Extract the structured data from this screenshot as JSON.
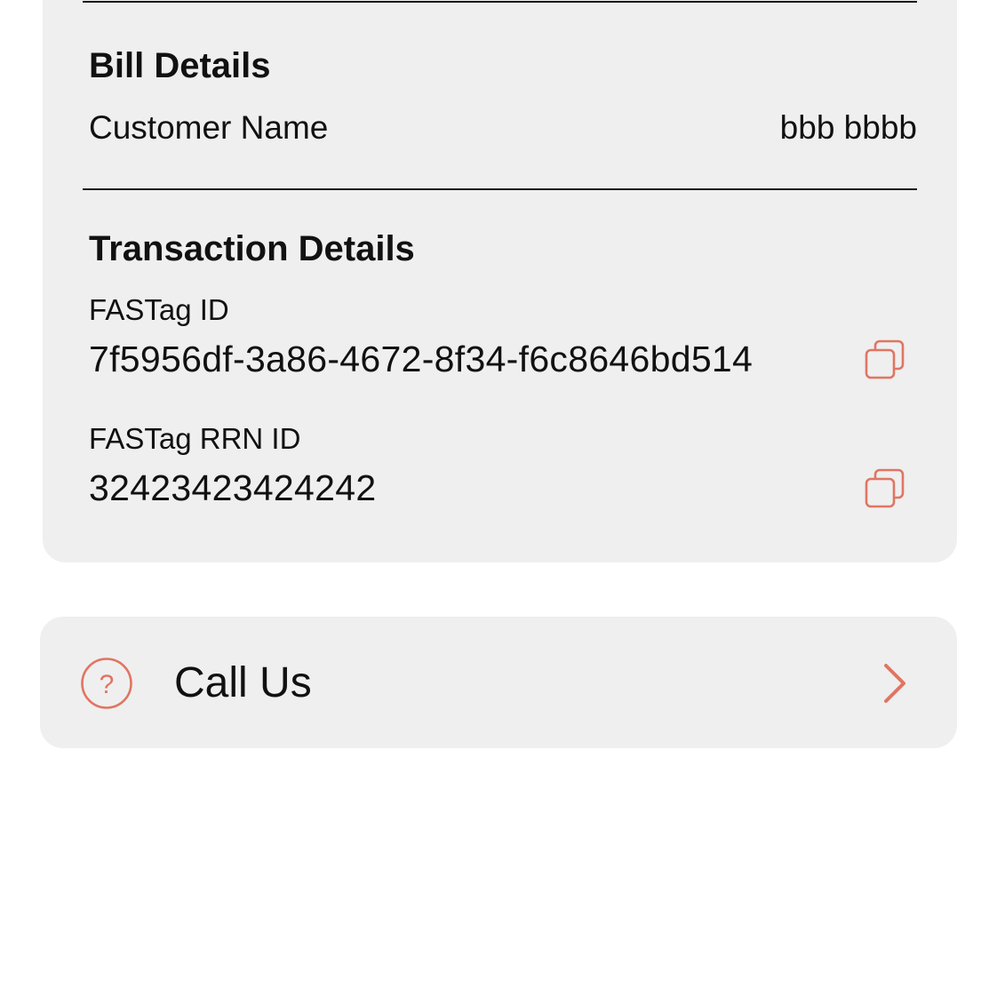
{
  "bill_details": {
    "title": "Bill Details",
    "customer_name_label": "Customer Name",
    "customer_name_value": "bbb bbbb"
  },
  "transaction_details": {
    "title": "Transaction Details",
    "fastag_id_label": "FASTag ID",
    "fastag_id_value": "7f5956df-3a86-4672-8f34-f6c8646bd514",
    "fastag_rrn_label": "FASTag RRN ID",
    "fastag_rrn_value": "32423423424242"
  },
  "help": {
    "call_us_label": "Call Us"
  },
  "icons": {
    "copy": "copy-icon",
    "help": "question-circle-icon",
    "chevron": "chevron-right-icon"
  },
  "colors": {
    "accent": "#e07563",
    "card_background": "#efefef",
    "text": "#111111"
  }
}
